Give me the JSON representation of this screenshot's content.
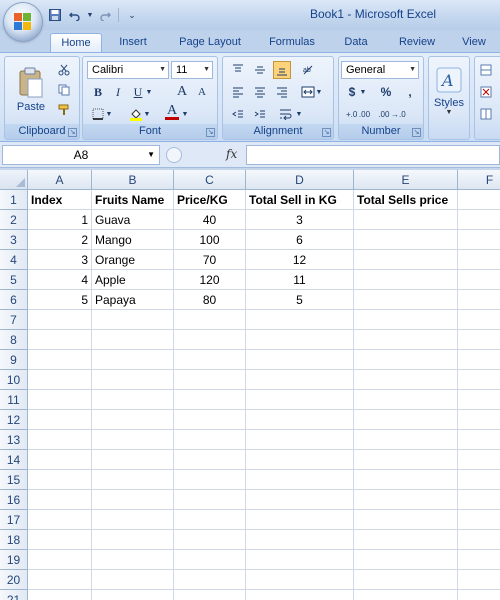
{
  "window": {
    "title": "Book1 - Microsoft Excel"
  },
  "quick_access": {
    "save_icon": "save-icon",
    "undo_icon": "undo-icon",
    "redo_icon": "redo-icon"
  },
  "tabs": [
    {
      "label": "Home",
      "active": true
    },
    {
      "label": "Insert"
    },
    {
      "label": "Page Layout"
    },
    {
      "label": "Formulas"
    },
    {
      "label": "Data"
    },
    {
      "label": "Review"
    },
    {
      "label": "View"
    }
  ],
  "ribbon": {
    "clipboard": {
      "label": "Clipboard",
      "paste_label": "Paste"
    },
    "font": {
      "label": "Font",
      "font_name": "Calibri",
      "font_size": "11",
      "bold": "B",
      "italic": "I",
      "underline": "U",
      "grow": "A",
      "shrink": "A",
      "fill": "A",
      "font_color": "A"
    },
    "alignment": {
      "label": "Alignment"
    },
    "number": {
      "label": "Number",
      "format": "General",
      "currency": "$",
      "percent": "%",
      "comma": ",",
      "inc_decimal": "+.0 .00",
      "dec_decimal": ".00 →.0"
    },
    "styles": {
      "label": "Styles"
    }
  },
  "formula_bar": {
    "name_box": "A8",
    "fx": "fx",
    "formula": ""
  },
  "sheet": {
    "columns": [
      "A",
      "B",
      "C",
      "D",
      "E",
      "F"
    ],
    "rows": [
      "1",
      "2",
      "3",
      "4",
      "5",
      "6",
      "7",
      "8",
      "9",
      "10",
      "11",
      "12",
      "13",
      "14",
      "15",
      "16",
      "17",
      "18",
      "19",
      "20",
      "21"
    ],
    "cells": {
      "A1": "Index",
      "B1": "Fruits Name",
      "C1": "Price/KG",
      "D1": "Total Sell in KG",
      "E1": "Total Sells price",
      "A2": "1",
      "B2": "Guava",
      "C2": "40",
      "D2": "3",
      "A3": "2",
      "B3": "Mango",
      "C3": "100",
      "D3": "6",
      "A4": "3",
      "B4": "Orange",
      "C4": "70",
      "D4": "12",
      "A5": "4",
      "B5": "Apple",
      "C5": "120",
      "D5": "11",
      "A6": "5",
      "B6": "Papaya",
      "C6": "80",
      "D6": "5"
    }
  }
}
